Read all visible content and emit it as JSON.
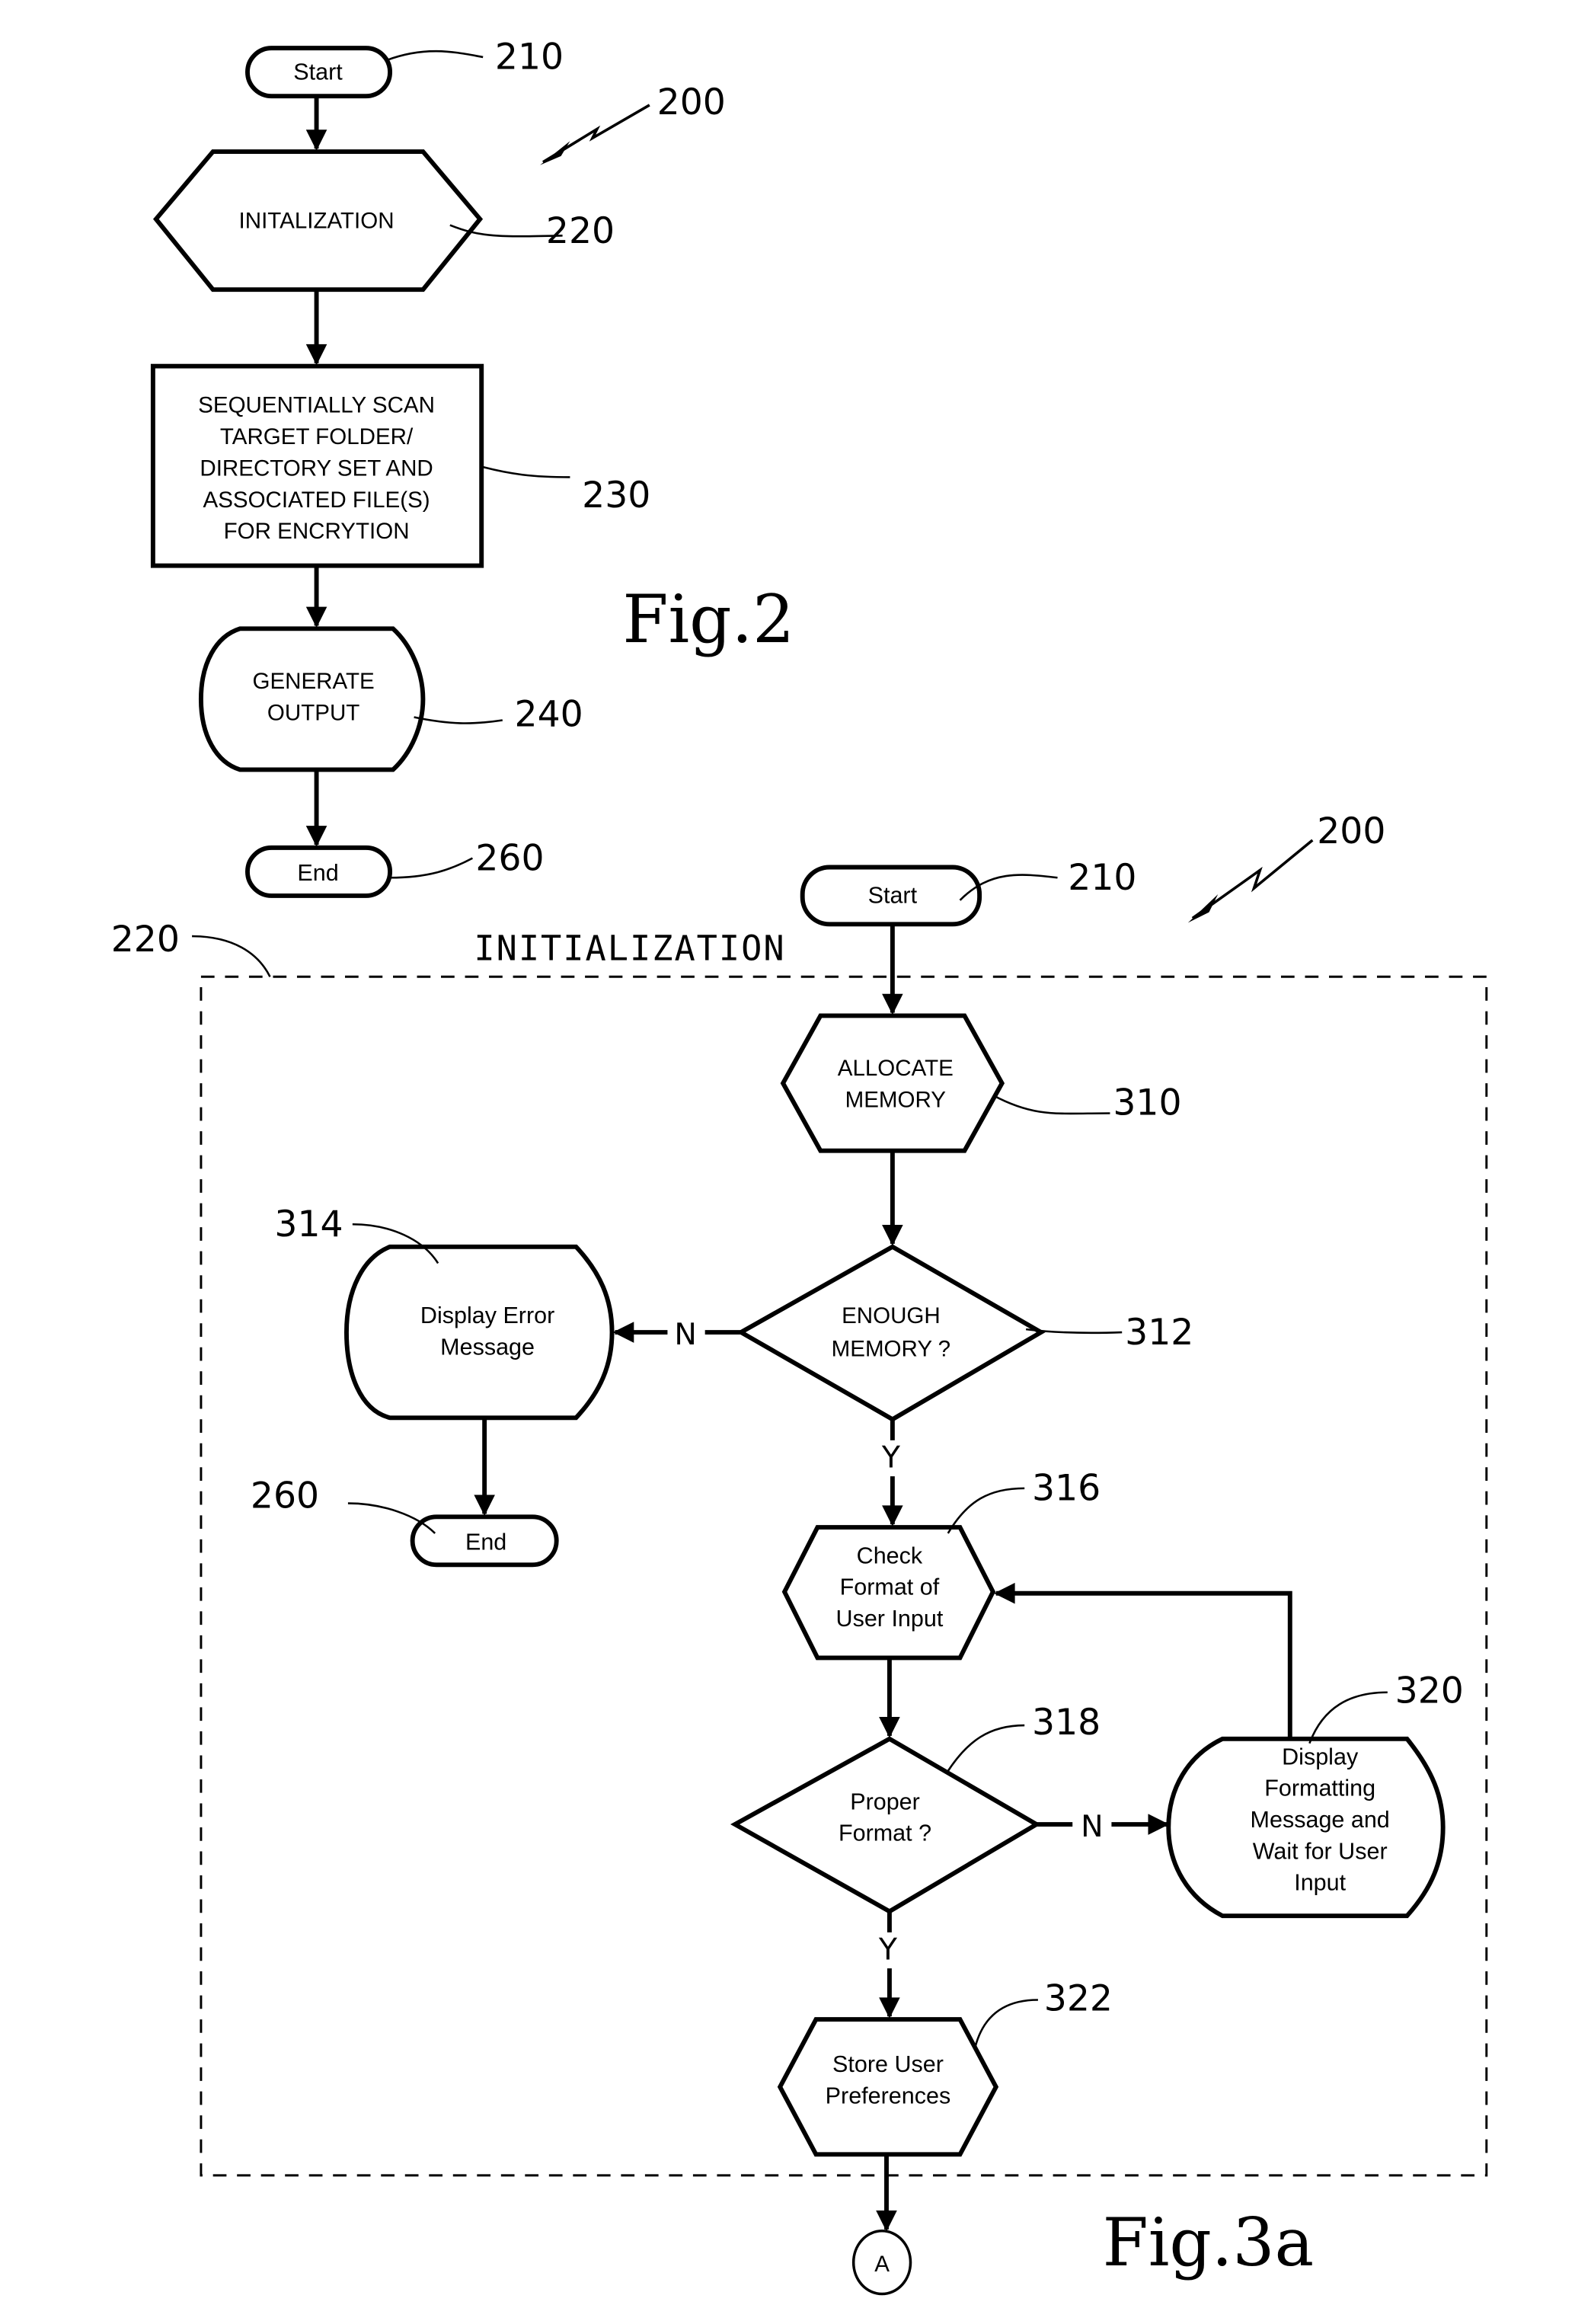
{
  "fig2": {
    "caption": "Fig.2",
    "ref_overall": "200",
    "nodes": {
      "start": {
        "label": "Start",
        "ref": "210"
      },
      "init": {
        "label": "INITALIZATION",
        "ref": "220"
      },
      "scan": {
        "lines": [
          "SEQUENTIALLY SCAN",
          "TARGET FOLDER/",
          "DIRECTORY SET AND",
          "ASSOCIATED FILE(S)",
          "FOR ENCRYTION"
        ],
        "ref": "230"
      },
      "output": {
        "lines": [
          "GENERATE",
          "OUTPUT"
        ],
        "ref": "240"
      },
      "end": {
        "label": "End",
        "ref": "260"
      }
    }
  },
  "fig3a": {
    "caption": "Fig.3a",
    "ref_overall": "200",
    "group": {
      "title": "INITIALIZATION",
      "ref": "220"
    },
    "nodes": {
      "start": {
        "label": "Start",
        "ref": "210"
      },
      "allocate": {
        "lines": [
          "ALLOCATE",
          "MEMORY"
        ],
        "ref": "310"
      },
      "enough": {
        "lines": [
          "ENOUGH",
          "MEMORY ?"
        ],
        "ref": "312"
      },
      "error": {
        "lines": [
          "Display Error",
          "Message"
        ],
        "ref": "314"
      },
      "end": {
        "label": "End",
        "ref": "260"
      },
      "check": {
        "lines": [
          "Check",
          "Format of",
          "User Input"
        ],
        "ref": "316"
      },
      "proper": {
        "lines": [
          "Proper",
          "Format ?"
        ],
        "ref": "318"
      },
      "display_fmt": {
        "lines": [
          "Display",
          "Formatting",
          "Message and",
          "Wait for User",
          "Input"
        ],
        "ref": "320"
      },
      "store": {
        "lines": [
          "Store User",
          "Preferences"
        ],
        "ref": "322"
      },
      "connector": {
        "label": "A"
      }
    },
    "edge_labels": {
      "no": "N",
      "yes": "Y"
    }
  }
}
